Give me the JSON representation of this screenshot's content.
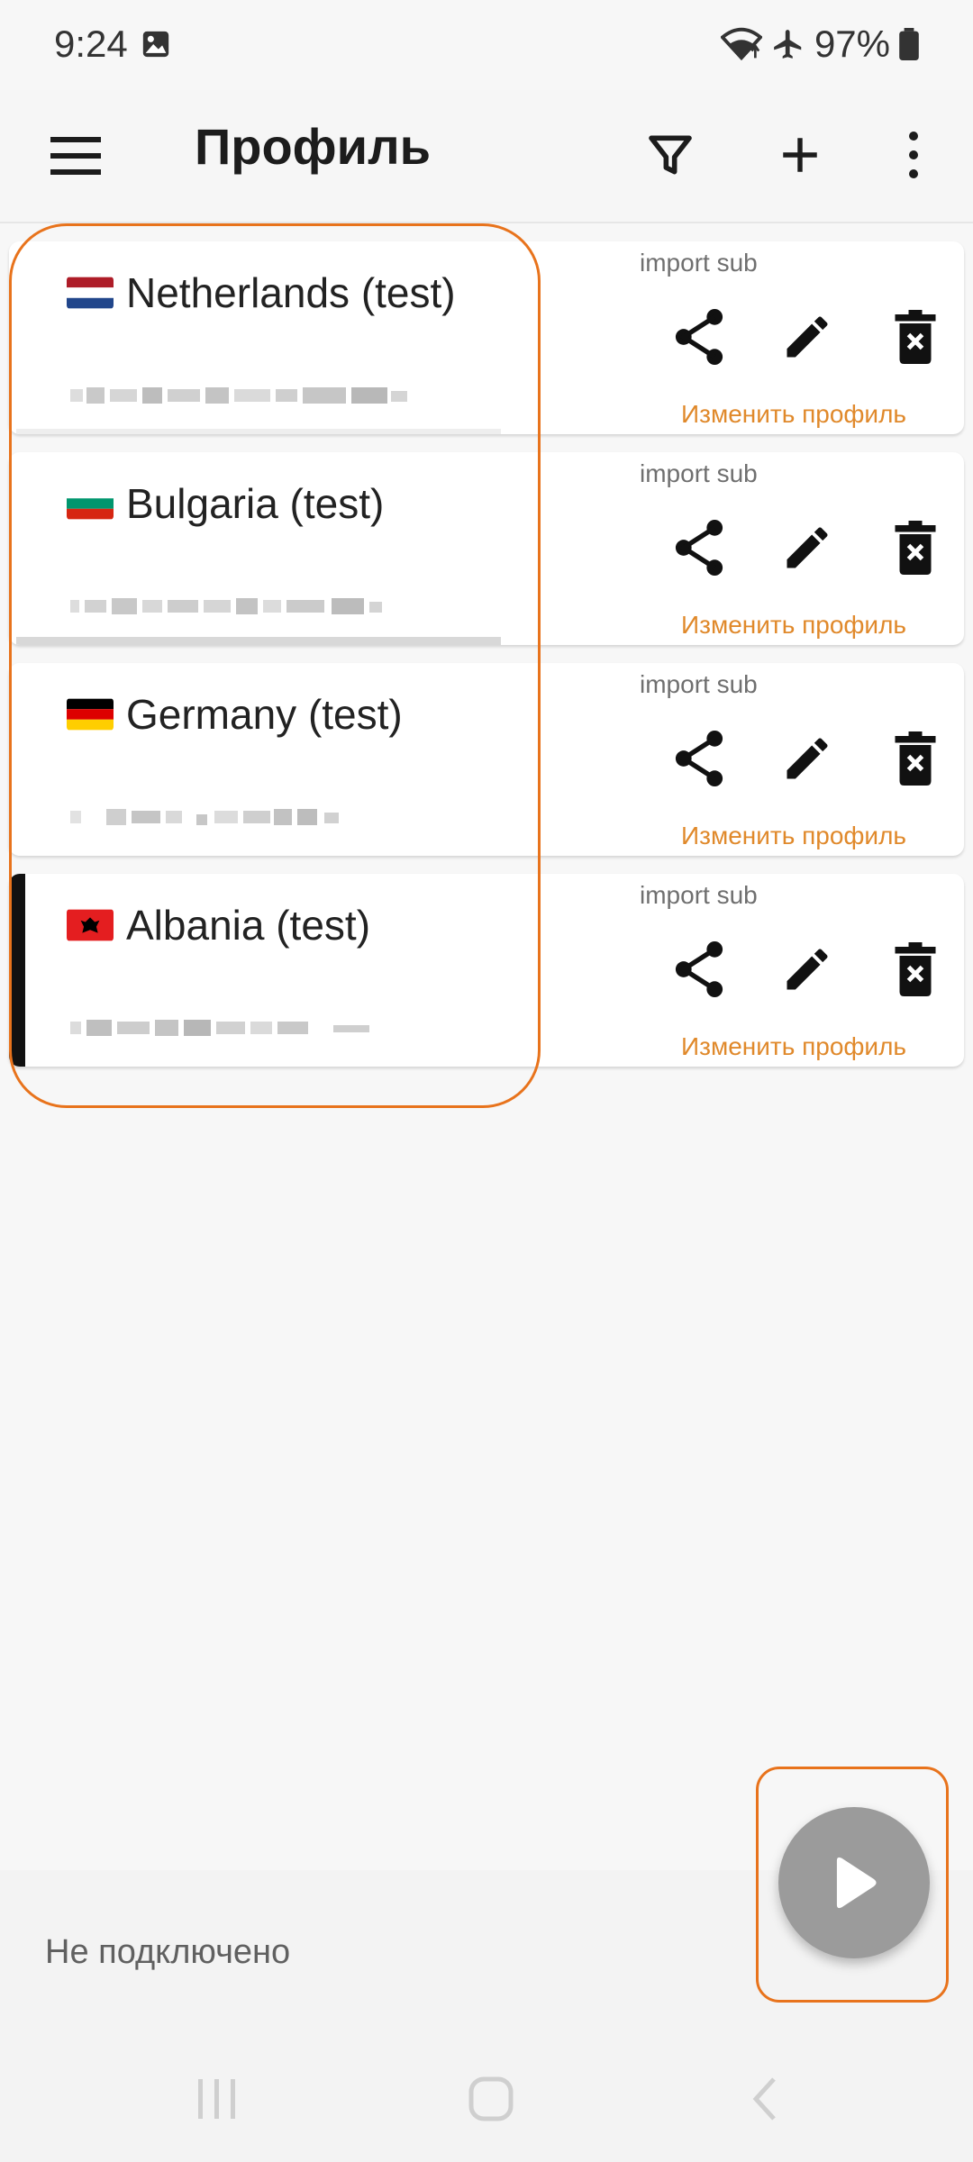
{
  "status_bar": {
    "time": "9:24",
    "battery": "97%",
    "icons": [
      "gallery-icon",
      "wifi-icon",
      "airplane-icon",
      "battery-icon"
    ]
  },
  "toolbar": {
    "title": "Профиль",
    "icons": [
      "menu-icon",
      "filter-icon",
      "add-icon",
      "more-vert-icon"
    ]
  },
  "profiles": [
    {
      "name": "Netherlands (test)",
      "flag": "NL",
      "subscription": "import sub",
      "edit_label": "Изменить профиль",
      "active": false
    },
    {
      "name": "Bulgaria (test)",
      "flag": "BG",
      "subscription": "import sub",
      "edit_label": "Изменить профиль",
      "active": false
    },
    {
      "name": "Germany (test)",
      "flag": "DE",
      "subscription": "import sub",
      "edit_label": "Изменить профиль",
      "active": false
    },
    {
      "name": "Albania (test)",
      "flag": "AL",
      "subscription": "import sub",
      "edit_label": "Изменить профиль",
      "active": true
    }
  ],
  "connection": {
    "status": "Не подключено"
  },
  "colors": {
    "accent": "#e0892b",
    "highlight": "#e8731c",
    "fab": "#9b9b9b"
  }
}
